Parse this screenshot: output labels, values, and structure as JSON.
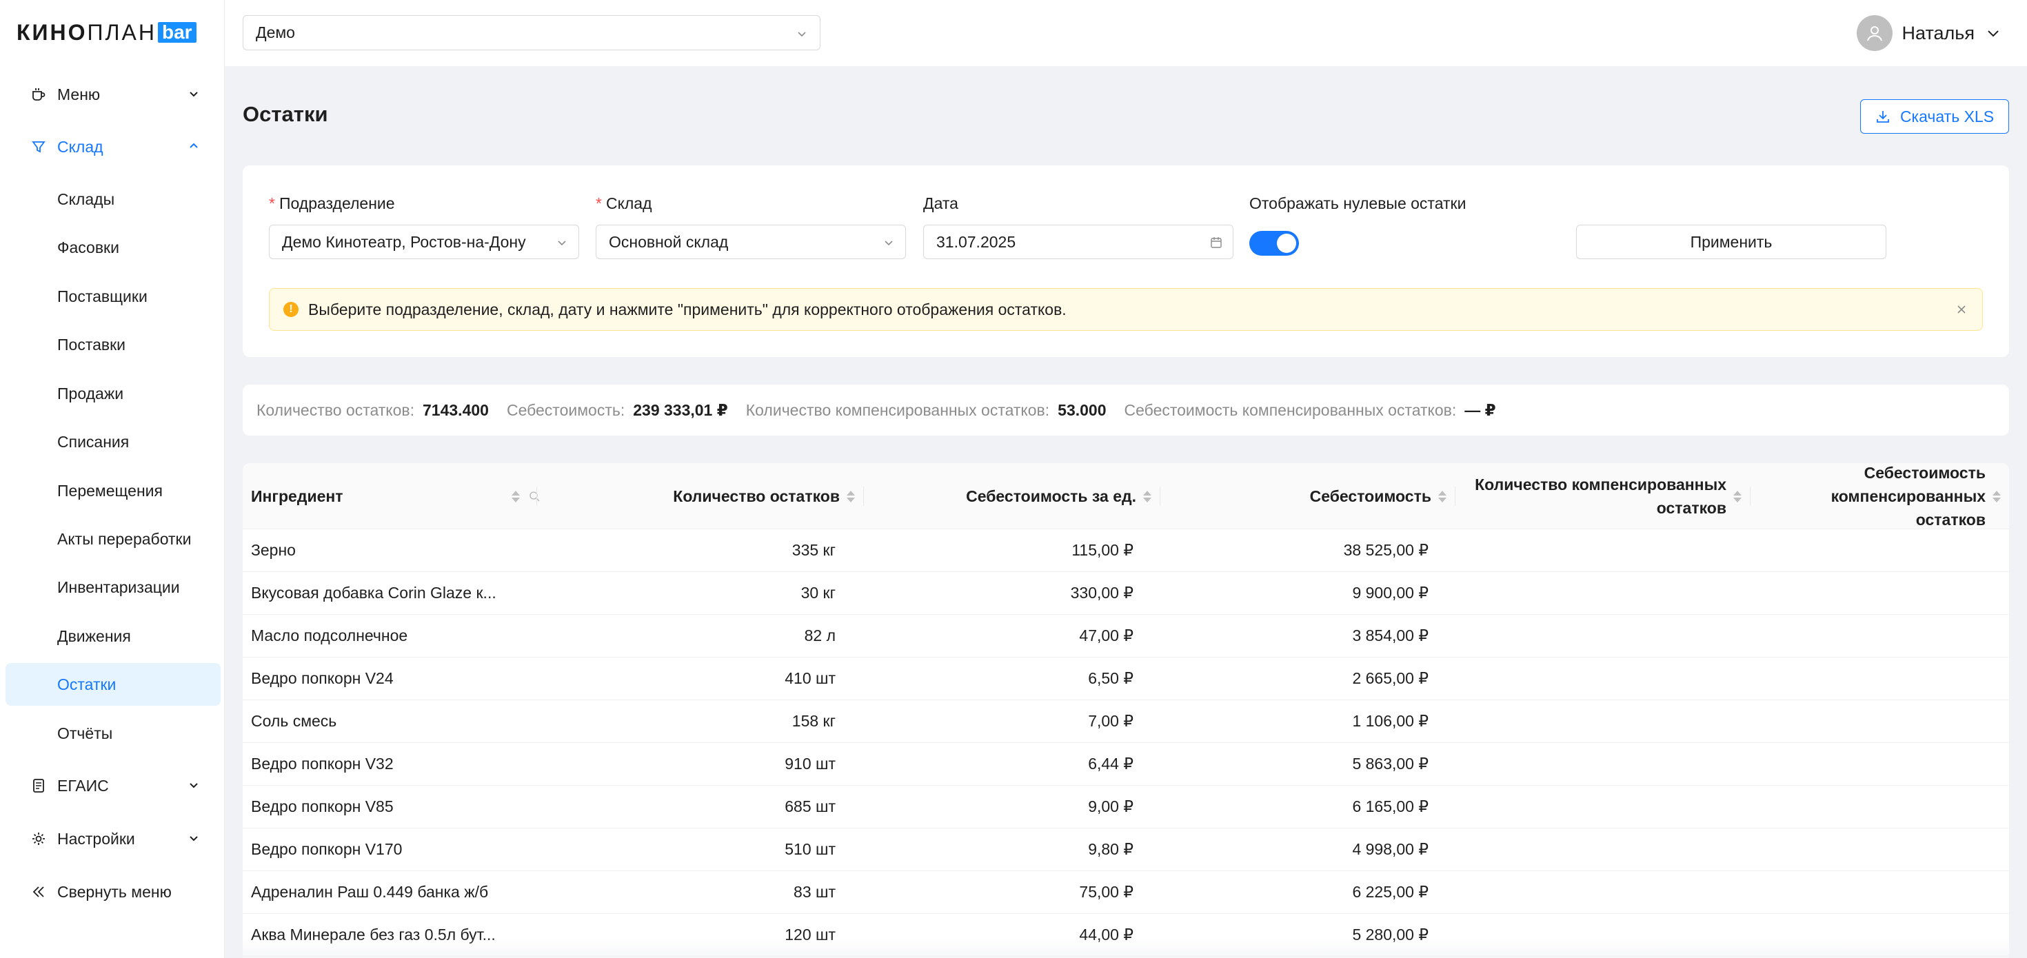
{
  "brand": {
    "part1": "КИНО",
    "part2": "ПЛАН",
    "part3": "bar"
  },
  "sidebar": {
    "menu": "Меню",
    "warehouse": "Склад",
    "sub": [
      "Склады",
      "Фасовки",
      "Поставщики",
      "Поставки",
      "Продажи",
      "Списания",
      "Перемещения",
      "Акты переработки",
      "Инвентаризации",
      "Движения",
      "Остатки",
      "Отчёты"
    ],
    "active_sub": "Остатки",
    "egais": "ЕГАИС",
    "settings": "Настройки",
    "collapse": "Свернуть меню"
  },
  "header": {
    "org_select": "Демо",
    "user_name": "Наталья"
  },
  "page": {
    "title": "Остатки",
    "download_btn": "Скачать XLS"
  },
  "filters": {
    "division_label": "Подразделение",
    "division_value": "Демо Кинотеатр, Ростов-на-Дону",
    "warehouse_label": "Склад",
    "warehouse_value": "Основной склад",
    "date_label": "Дата",
    "date_value": "31.07.2025",
    "zero_label": "Отображать нулевые остатки",
    "zero_enabled": true,
    "apply_btn": "Применить",
    "required_mark": "*"
  },
  "alert": {
    "text": "Выберите подразделение, склад, дату и нажмите \"применить\" для корректного отображения остатков."
  },
  "stats": {
    "qty_label": "Количество остатков:",
    "qty_value": "7143.400",
    "cost_label": "Себестоимость:",
    "cost_value": "239 333,01 ₽",
    "comp_qty_label": "Количество компенсированных остатков:",
    "comp_qty_value": "53.000",
    "comp_cost_label": "Себестоимость компенсированных остатков:",
    "comp_cost_value": "— ₽"
  },
  "table": {
    "columns": {
      "ingredient": "Ингредиент",
      "qty": "Количество остатков",
      "unit_cost": "Себестоимость за ед.",
      "cost": "Себестоимость",
      "comp_qty_1": "Количество компенсированных",
      "comp_qty_2": "остатков",
      "comp_cost_1": "Себестоимость",
      "comp_cost_2": "компенсированных остатков"
    },
    "rows": [
      {
        "name": "Зерно",
        "qty": "335 кг",
        "unit_cost": "115,00 ₽",
        "cost": "38 525,00 ₽"
      },
      {
        "name": "Вкусовая добавка Corin Glaze к...",
        "qty": "30 кг",
        "unit_cost": "330,00 ₽",
        "cost": "9 900,00 ₽"
      },
      {
        "name": "Масло подсолнечное",
        "qty": "82 л",
        "unit_cost": "47,00 ₽",
        "cost": "3 854,00 ₽"
      },
      {
        "name": "Ведро попкорн V24",
        "qty": "410 шт",
        "unit_cost": "6,50 ₽",
        "cost": "2 665,00 ₽"
      },
      {
        "name": "Соль смесь",
        "qty": "158 кг",
        "unit_cost": "7,00 ₽",
        "cost": "1 106,00 ₽"
      },
      {
        "name": "Ведро попкорн V32",
        "qty": "910 шт",
        "unit_cost": "6,44 ₽",
        "cost": "5 863,00 ₽"
      },
      {
        "name": "Ведро попкорн V85",
        "qty": "685 шт",
        "unit_cost": "9,00 ₽",
        "cost": "6 165,00 ₽"
      },
      {
        "name": "Ведро попкорн V170",
        "qty": "510 шт",
        "unit_cost": "9,80 ₽",
        "cost": "4 998,00 ₽"
      },
      {
        "name": "Адреналин Раш 0.449 банка ж/б",
        "qty": "83 шт",
        "unit_cost": "75,00 ₽",
        "cost": "6 225,00 ₽"
      },
      {
        "name": "Аква Минерале без газ 0.5л бут...",
        "qty": "120 шт",
        "unit_cost": "44,00 ₽",
        "cost": "5 280,00 ₽"
      }
    ]
  },
  "colors": {
    "accent": "#1677ff",
    "alert_bg": "#fffbe6",
    "warn": "#faad14"
  }
}
